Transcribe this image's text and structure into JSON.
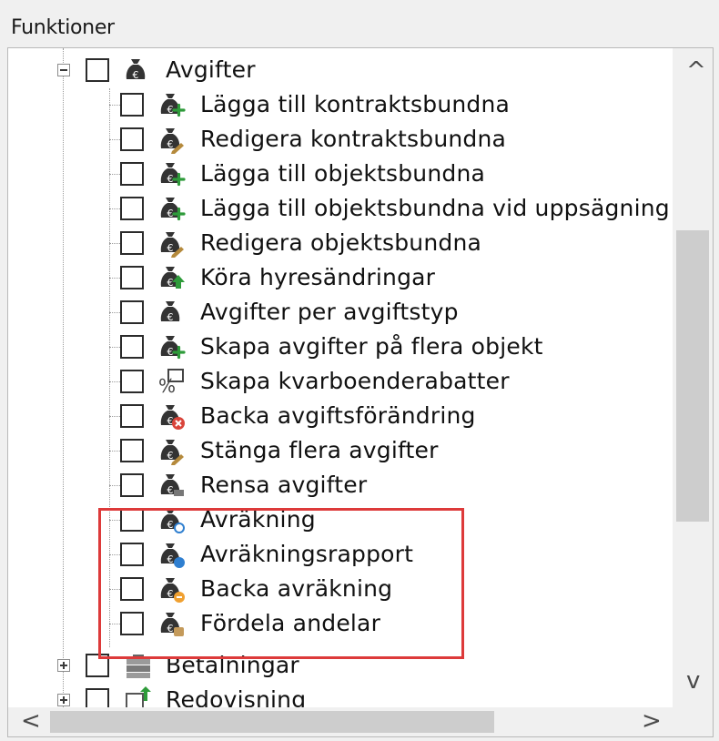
{
  "panel": {
    "title": "Funktioner"
  },
  "tree": {
    "parent": {
      "label": "Avgifter",
      "icon": "money-bag-icon"
    },
    "children": [
      {
        "label": "Lägga till kontraktsbundna",
        "icon": "money-bag-add-icon"
      },
      {
        "label": "Redigera kontraktsbundna",
        "icon": "money-bag-edit-icon"
      },
      {
        "label": "Lägga till objektsbundna",
        "icon": "money-bag-add-icon"
      },
      {
        "label": "Lägga till objektsbundna vid uppsägning",
        "icon": "money-bag-add-icon"
      },
      {
        "label": "Redigera objektsbundna",
        "icon": "money-bag-edit-icon"
      },
      {
        "label": "Köra hyresändringar",
        "icon": "money-bag-up-arrow-icon"
      },
      {
        "label": "Avgifter per avgiftstyp",
        "icon": "money-bag-icon"
      },
      {
        "label": "Skapa avgifter på flera objekt",
        "icon": "money-bag-add-icon"
      },
      {
        "label": "Skapa kvarboenderabatter",
        "icon": "percent-discount-icon"
      },
      {
        "label": "Backa avgiftsförändring",
        "icon": "money-bag-cancel-icon"
      },
      {
        "label": "Stänga flera avgifter",
        "icon": "money-bag-edit-icon"
      },
      {
        "label": "Rensa avgifter",
        "icon": "money-bag-clear-icon"
      },
      {
        "label": "Avräkning",
        "icon": "money-bag-settle-icon"
      },
      {
        "label": "Avräkningsrapport",
        "icon": "money-bag-report-icon"
      },
      {
        "label": "Backa avräkning",
        "icon": "money-bag-undo-icon"
      },
      {
        "label": "Fördela andelar",
        "icon": "money-bag-share-icon"
      }
    ],
    "siblings": [
      {
        "label": "Betalningar",
        "icon": "banknotes-icon"
      },
      {
        "label": "Redovisning",
        "icon": "ledger-arrow-icon"
      }
    ]
  },
  "scrollbars": {
    "up_arrow": "^",
    "down_arrow": "v",
    "left_arrow": "<",
    "right_arrow": ">"
  },
  "colors": {
    "highlight": "#dd3a3a",
    "add_green": "#2e9b3a",
    "edit_brown": "#b58a3c",
    "cancel_red": "#d9443a",
    "info_blue": "#2f7fd0",
    "bag_dark": "#333333"
  }
}
